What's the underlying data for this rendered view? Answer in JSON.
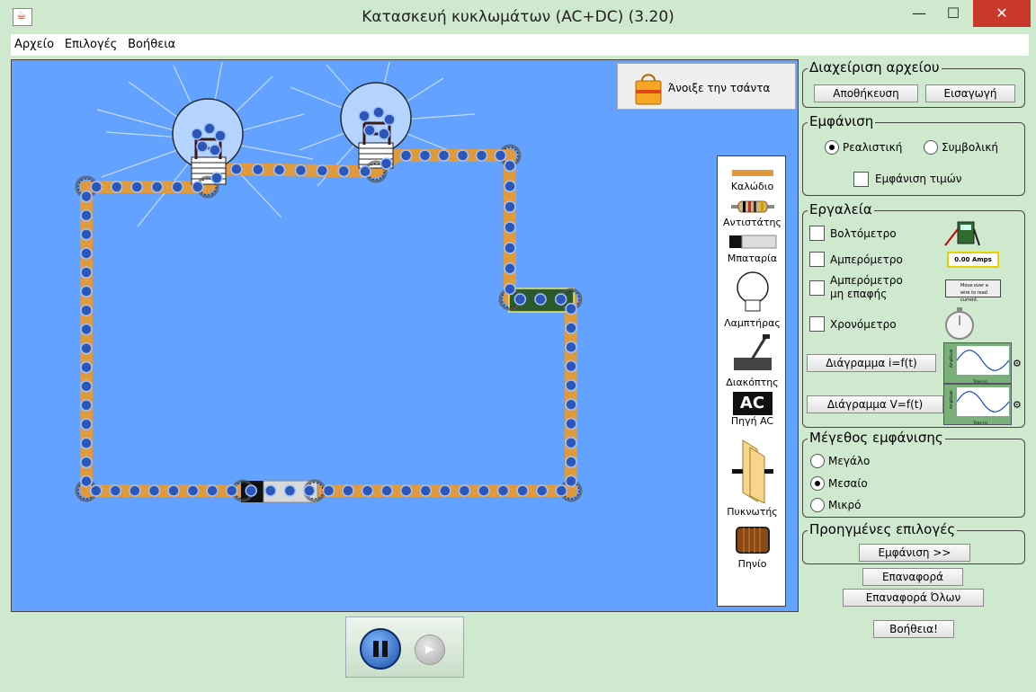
{
  "window": {
    "title": "Κατασκευή κυκλωμάτων (AC+DC) (3.20)",
    "min_glyph": "—",
    "max_glyph": "☐",
    "close_glyph": "✕"
  },
  "menu": [
    "Αρχείο",
    "Επιλογές",
    "Βοήθεια"
  ],
  "canvas": {
    "bag_label": "Άνοιξε την τσάντα",
    "background_color": "#63a2ff",
    "wire_color": "#e09a3c",
    "electron_color": "#2c57b8"
  },
  "toolbox": {
    "items": [
      {
        "name": "wire",
        "label": "Καλώδιο",
        "icon": "wire-icon"
      },
      {
        "name": "resistor",
        "label": "Αντιστάτης",
        "icon": "resistor-icon"
      },
      {
        "name": "battery",
        "label": "Μπαταρία",
        "icon": "battery-icon"
      },
      {
        "name": "bulb",
        "label": "Λαμπτήρας",
        "icon": "bulb-icon"
      },
      {
        "name": "switch",
        "label": "Διακόπτης",
        "icon": "switch-icon"
      },
      {
        "name": "ac-source",
        "label": "Πηγή AC",
        "icon": "ac-source-icon",
        "icon_text": "AC"
      },
      {
        "name": "capacitor",
        "label": "Πυκνωτής",
        "icon": "capacitor-icon"
      },
      {
        "name": "inductor",
        "label": "Πηνίο",
        "icon": "inductor-icon"
      }
    ]
  },
  "file_panel": {
    "title": "Διαχείριση αρχείου",
    "save": "Αποθήκευση",
    "import": "Εισαγωγή"
  },
  "view_panel": {
    "title": "Εμφάνιση",
    "realistic": "Ρεαλιστική",
    "schematic": "Συμβολική",
    "selected": "realistic",
    "show_values": "Εμφάνιση τιμών",
    "show_values_checked": false
  },
  "tools_panel": {
    "title": "Εργαλεία",
    "voltmeter": "Βολτόμετρο",
    "ammeter": "Αμπερόμετρο",
    "noncontact_ammeter": [
      "Αμπερόμετρο",
      "μη επαφής"
    ],
    "stopwatch": "Χρονόμετρο",
    "ammeter_readout": "0.00 Amps",
    "noncontact_readout": "Move over a wire to read current.",
    "chart_i": "Διάγραμμα  i=f(t)",
    "chart_v": "Διάγραμμα  V=f(t)",
    "mini_chart_y": "Amplitude",
    "mini_chart_x": "Time (s)",
    "mini_chart_ticks_y": [
      "1.0",
      "0.5",
      "0.0",
      "-0.5",
      "-1.0"
    ],
    "mini_chart_ticks_x": [
      "31",
      "32",
      "33",
      "34"
    ]
  },
  "size_panel": {
    "title": "Μέγεθος εμφάνισης",
    "options": [
      "Μεγάλο",
      "Μεσαίο",
      "Μικρό"
    ],
    "selected_index": 1
  },
  "advanced_panel": {
    "title": "Προηγμένες επιλογές",
    "show": "Εμφάνιση >>"
  },
  "actions": {
    "reset": "Επαναφορά",
    "reset_all": "Επαναφορά Όλων",
    "help": "Βοήθεια!"
  },
  "playback": {
    "pause": "pause-icon",
    "step": "step-icon"
  }
}
